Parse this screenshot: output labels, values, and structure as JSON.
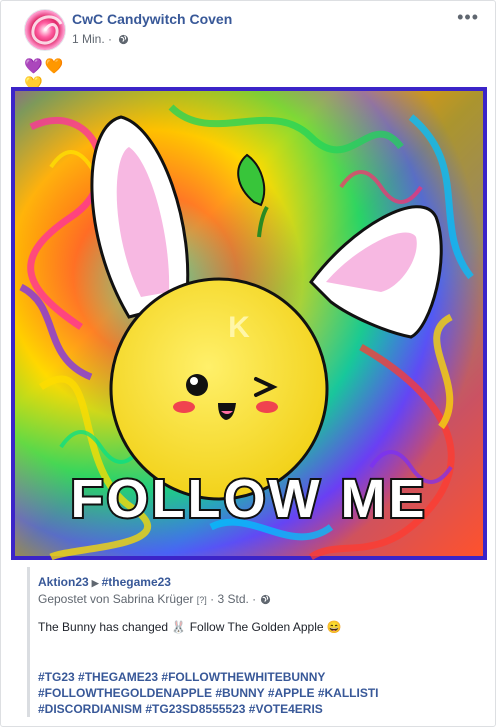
{
  "post": {
    "page_name": "CwC Candywitch Coven",
    "time": "1 Min.",
    "separator": " · ",
    "more_label": "•••",
    "hearts": [
      "💜",
      "🧡",
      "💛"
    ],
    "image_text": "FOLLOW ME",
    "image_letter": "K"
  },
  "shared": {
    "source": "Aktion23",
    "arrow": "▶",
    "target": "#thegame23",
    "posted_by": "Gepostet von Sabrina Krüger",
    "help": "[?]",
    "time": "· 3 Std. ·",
    "text": "The Bunny has changed 🐰 Follow The Golden Apple 😄",
    "hashtags": [
      "#TG23",
      "#THEGAME23",
      "#FOLLOWTHEWHITEBUNNY",
      "#FOLLOWTHEGOLDENAPPLE",
      "#BUNNY",
      "#APPLE",
      "#KALLISTI",
      "#DISCORDIANISM",
      "#TG23SD8555523",
      "#VOTE4ERIS"
    ]
  },
  "colors": {
    "link": "#385898",
    "meta": "#606770",
    "apple": "#f5e11e",
    "frame": "#3b24c8"
  },
  "icons": [
    "globe-icon",
    "more-icon",
    "rainbow-swirl-avatar"
  ]
}
